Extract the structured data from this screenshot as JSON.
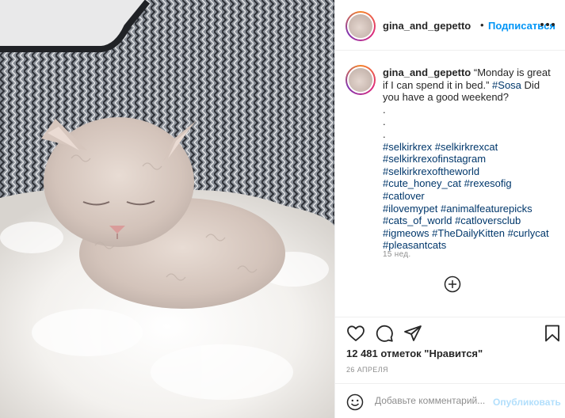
{
  "post": {
    "username": "gina_and_gepetto",
    "dot": "•",
    "follow_label": "Подписаться",
    "photo_alt": "selkirk rex kitten sleeping on fluffy white fur"
  },
  "caption": {
    "username": "gina_and_gepetto",
    "text": "“Monday is great if I can spend it in bed.”",
    "mention": "#Sosa",
    "text_after": "Did you have a good weekend?",
    "dots": [
      ".",
      ".",
      "."
    ],
    "hashtags_lines": [
      [
        "#selkirkrex",
        "#selkirkrexcat"
      ],
      [
        "#selkirkrexofinstagram"
      ],
      [
        "#selkirkrexoftheworld"
      ],
      [
        "#cute_honey_cat",
        "#rexesofig",
        "#catlover"
      ],
      [
        "#ilovemypet",
        "#animalfeaturepicks"
      ],
      [
        "#cats_of_world",
        "#catloversclub"
      ],
      [
        "#igmeows",
        "#TheDailyKitten",
        "#curlycat"
      ],
      [
        "#pleasantcats"
      ]
    ],
    "time": "15 нед."
  },
  "engagement": {
    "likes": "12 481 отметок \"Нравится\"",
    "date": "26 АПРЕЛЯ"
  },
  "comment_box": {
    "placeholder": "Добавьте комментарий...",
    "publish_label": "Опубликовать"
  },
  "icons": {
    "more": "more-options-icon",
    "like": "heart-icon",
    "comment": "comment-icon",
    "share": "share-icon",
    "save": "bookmark-icon",
    "load_more": "plus-circle-icon",
    "emoji": "emoji-icon"
  },
  "colors": {
    "link_blue": "#0095f6",
    "hashtag": "#00376b",
    "muted": "#8e8e8e",
    "publish_disabled": "#b2dffc"
  }
}
